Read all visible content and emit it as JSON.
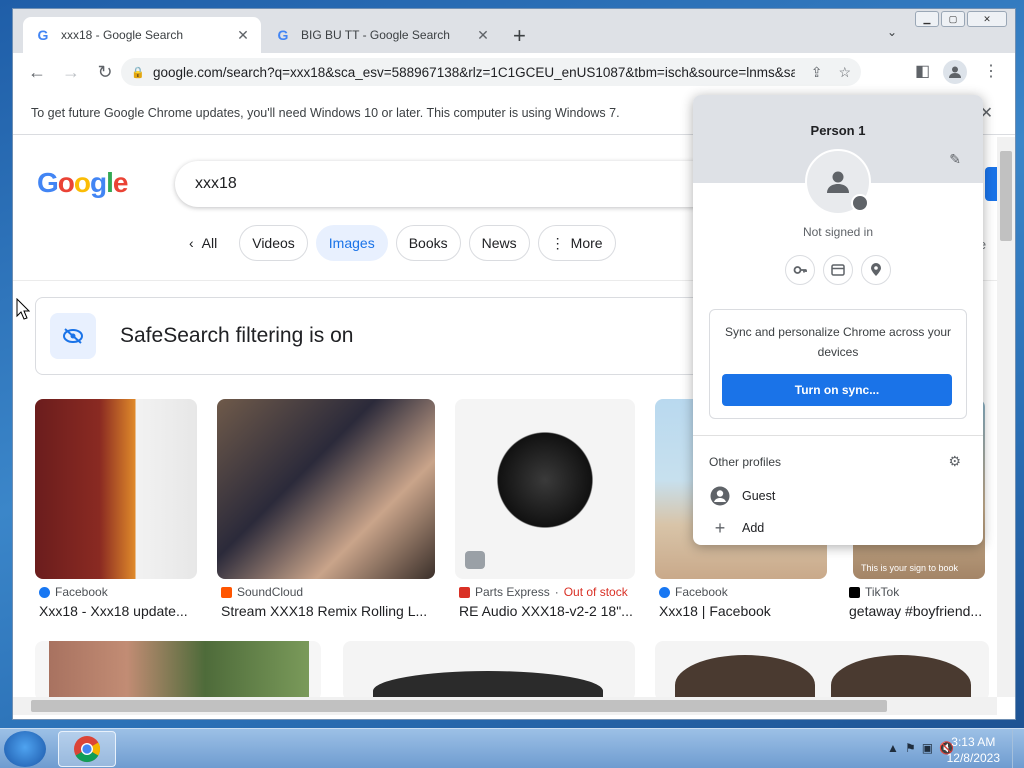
{
  "window": {
    "tabs": [
      {
        "title": "xxx18 - Google Search",
        "active": true
      },
      {
        "title": "BIG BU TT - Google Search",
        "active": false
      }
    ],
    "new_tab_label": "+",
    "url": "google.com/search?q=xxx18&sca_esv=588967138&rlz=1C1GCEU_enUS1087&tbm=isch&source=lnms&sa...",
    "infobar": "To get future Google Chrome updates, you'll need Windows 10 or later. This computer is using Windows 7."
  },
  "page": {
    "logo_letters": [
      "G",
      "o",
      "o",
      "g",
      "l",
      "e"
    ],
    "search_query": "xxx18",
    "all_label": "All",
    "chips": [
      {
        "label": "Videos",
        "selected": false
      },
      {
        "label": "Images",
        "selected": true
      },
      {
        "label": "Books",
        "selected": false
      },
      {
        "label": "News",
        "selected": false
      },
      {
        "label": "More",
        "selected": false
      }
    ],
    "safesearch_partial": "eSe",
    "safesearch_text": "SafeSearch filtering is on",
    "results": [
      {
        "source": "Facebook",
        "caption": "Xxx18 - Xxx18 update...",
        "color": "#1877f2"
      },
      {
        "source": "SoundCloud",
        "caption": "Stream XXX18 Remix Rolling L...",
        "color": "#ff5500"
      },
      {
        "source": "Parts Express",
        "status": "Out of stock",
        "caption": "RE Audio XXX18-v2-2 18\"...",
        "color": "#d93025"
      },
      {
        "source": "Facebook",
        "caption": "Xxx18 | Facebook",
        "color": "#1877f2"
      },
      {
        "source": "TikTok",
        "caption": "getaway #boyfriend...",
        "color": "#000000",
        "overlay": "This is your sign to book"
      }
    ]
  },
  "profile_menu": {
    "name": "Person 1",
    "status": "Not signed in",
    "sync_text": "Sync and personalize Chrome across your devices",
    "sync_button": "Turn on sync...",
    "other_profiles_label": "Other profiles",
    "guest_label": "Guest",
    "add_label": "Add"
  },
  "taskbar": {
    "time": "3:13 AM",
    "date": "12/8/2023"
  }
}
